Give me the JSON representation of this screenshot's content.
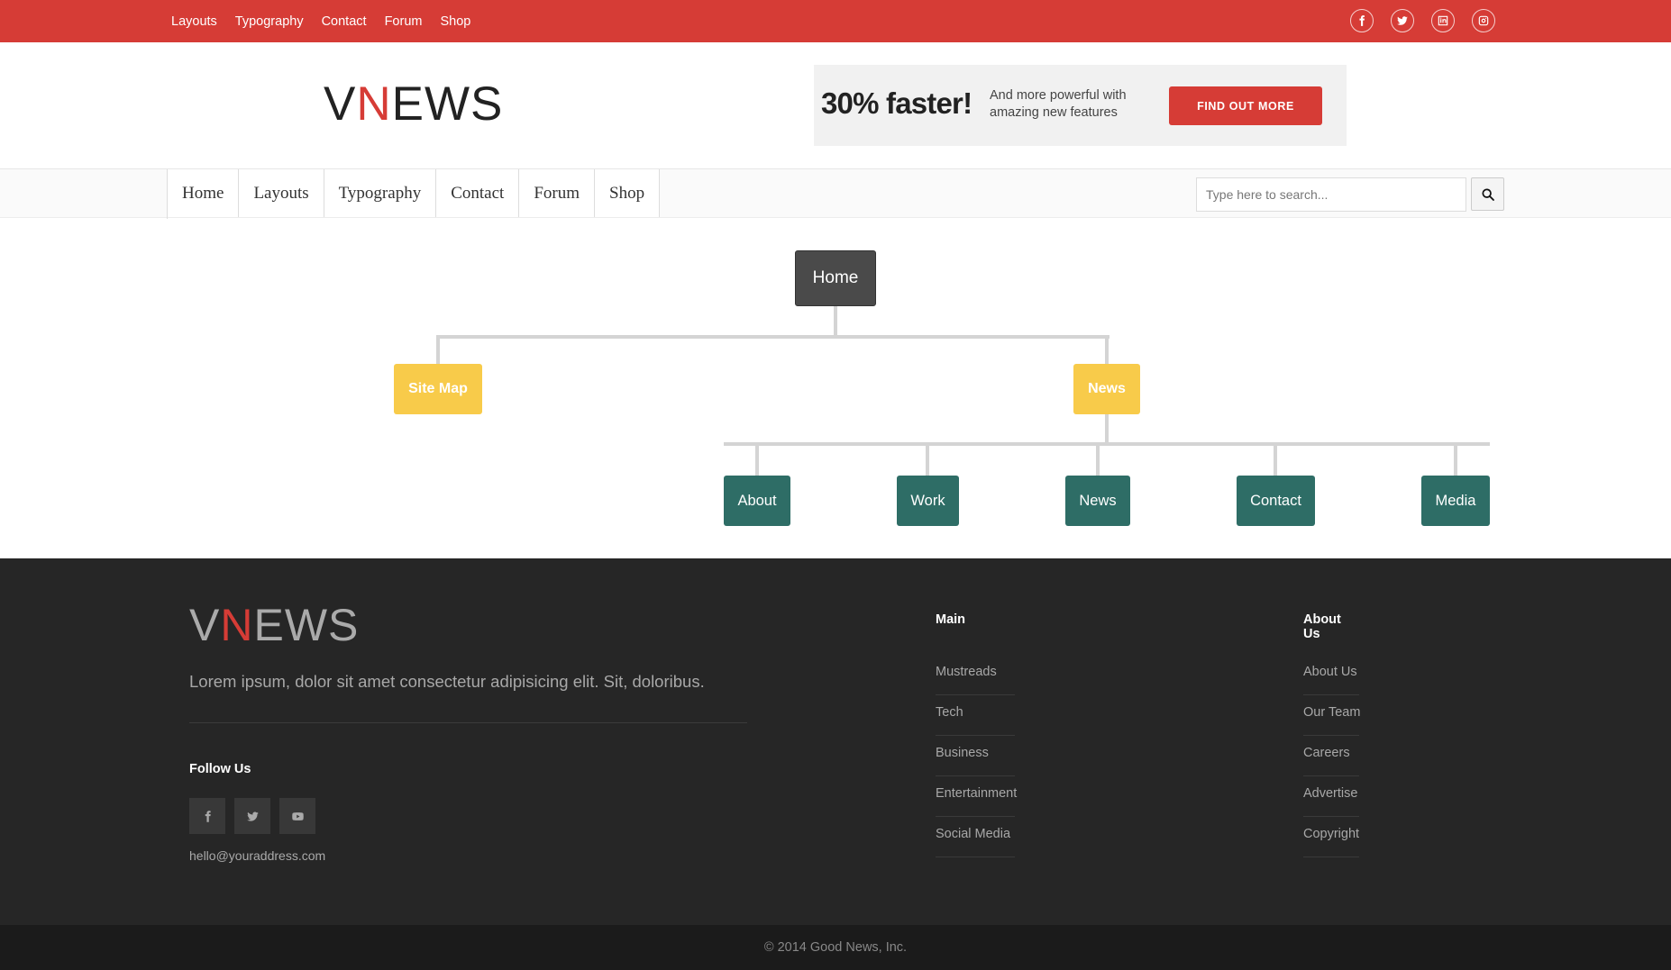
{
  "topbar": {
    "links": [
      "Layouts",
      "Typography",
      "Contact",
      "Forum",
      "Shop"
    ],
    "social_icons": [
      "facebook-icon",
      "twitter-icon",
      "linkedin-icon",
      "instagram-icon"
    ],
    "color": "#d63c36"
  },
  "header": {
    "logo": {
      "prefix": "V",
      "accent": "N",
      "suffix": "EWS"
    },
    "ad": {
      "headline": "30% faster!",
      "text": "And more powerful with amazing new features",
      "button": "FIND OUT MORE"
    }
  },
  "nav": {
    "items": [
      "Home",
      "Layouts",
      "Typography",
      "Contact",
      "Forum",
      "Shop"
    ],
    "search_placeholder": "Type here to search..."
  },
  "sitemap": {
    "root": "Home",
    "level1": [
      "Site Map",
      "News"
    ],
    "level2": [
      "About",
      "Work",
      "News",
      "Contact",
      "Media"
    ],
    "colors": {
      "root": "#4a4a4a",
      "level1": "#f8cb4a",
      "level2": "#2e6d66",
      "lines": "#d4d4d4"
    }
  },
  "footer": {
    "logo": {
      "prefix": "V",
      "accent": "N",
      "suffix": "EWS"
    },
    "description": "Lorem ipsum, dolor sit amet consectetur adipisicing elit. Sit, doloribus.",
    "follow_title": "Follow Us",
    "social_icons": [
      "facebook-icon",
      "twitter-icon",
      "youtube-icon"
    ],
    "email": "hello@youraddress.com",
    "main": {
      "title": "Main",
      "links": [
        "Mustreads",
        "Tech",
        "Business",
        "Entertainment",
        "Social Media"
      ]
    },
    "about": {
      "title": "About Us",
      "links": [
        "About Us",
        "Our Team",
        "Careers",
        "Advertise",
        "Copyright"
      ]
    },
    "copyright": "© 2014 Good News, Inc."
  }
}
